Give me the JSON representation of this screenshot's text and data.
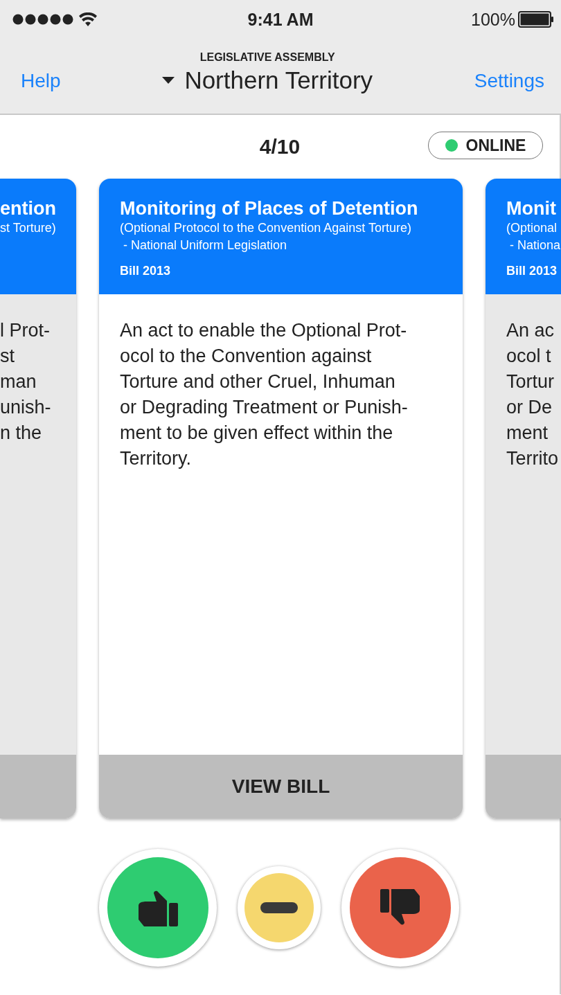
{
  "status_bar": {
    "time": "9:41 AM",
    "battery": "100%"
  },
  "nav": {
    "left": "Help",
    "kicker": "LEGISLATIVE ASSEMBLY",
    "title": "Northern Territory",
    "right": "Settings"
  },
  "counter": "4/10",
  "connection": {
    "label": "ONLINE"
  },
  "cards": [
    {
      "kind": "clipped-left",
      "title": "ention",
      "subtitle": "st Torture)",
      "body": "l Prot-\nst\nman\nunish-\nn the"
    },
    {
      "kind": "full",
      "title": "Monitoring of Places of Detention",
      "subtitle": "(Optional Protocol to the Convention Against Torture)\n - National Uniform Legislation",
      "bill": "Bill 2013",
      "body": "An act to enable the Optional Prot-\nocol to the Convention against\nTorture and other Cruel, Inhuman\nor Degrading Treatment or Punish-\nment to be given effect within the\nTerritory.",
      "action": "VIEW BILL"
    },
    {
      "kind": "clipped-right",
      "title": "Monit",
      "subtitle": "(Optional\n - Nationa",
      "bill": "Bill 2013",
      "body": "An ac\nocol t\nTortur\nor De\nment\nTerrito"
    }
  ],
  "votes": [
    {
      "kind": "yes"
    },
    {
      "kind": "abstain"
    },
    {
      "kind": "no"
    }
  ]
}
